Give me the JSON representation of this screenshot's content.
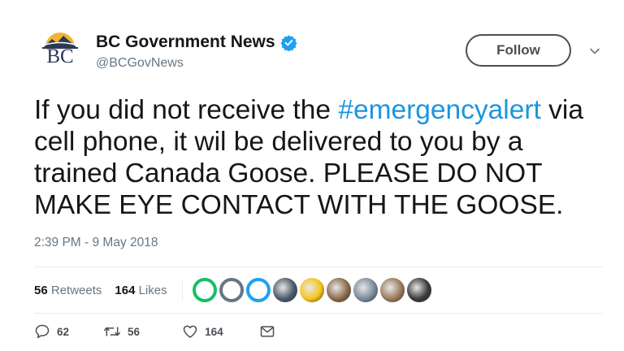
{
  "account": {
    "display_name": "BC Government News",
    "handle": "@BCGovNews",
    "avatar_text": "BC",
    "verified": true
  },
  "follow_button": {
    "label": "Follow"
  },
  "tweet": {
    "segments": [
      {
        "text": "If you did not receive the ",
        "type": "text"
      },
      {
        "text": "#emergencyalert",
        "type": "hashtag"
      },
      {
        "text": " via cell phone, it wil be delivered to you by a trained Canada Goose. PLEASE DO NOT MAKE EYE CONTACT WITH THE GOOSE.",
        "type": "text"
      }
    ],
    "timestamp": "2:39 PM - 9 May 2018"
  },
  "stats": {
    "retweets_count": "56",
    "retweets_label": "Retweets",
    "likes_count": "164",
    "likes_label": "Likes"
  },
  "likers": [
    {
      "kind": "egg",
      "color": "#17bf63"
    },
    {
      "kind": "egg",
      "color": "#657786"
    },
    {
      "kind": "egg",
      "color": "#1da1f2"
    },
    {
      "kind": "photo",
      "color": "#4a5a6a"
    },
    {
      "kind": "photo",
      "color": "#f5c518"
    },
    {
      "kind": "photo",
      "color": "#8a6a4a"
    },
    {
      "kind": "photo",
      "color": "#7a8a9a"
    },
    {
      "kind": "photo",
      "color": "#9a7a5a"
    },
    {
      "kind": "photo",
      "color": "#3a3a3a"
    }
  ],
  "actions": {
    "reply_count": "62",
    "retweet_count": "56",
    "like_count": "164"
  },
  "colors": {
    "link": "#1b95e0",
    "verified": "#1da1f2",
    "secondary_text": "#657786"
  }
}
